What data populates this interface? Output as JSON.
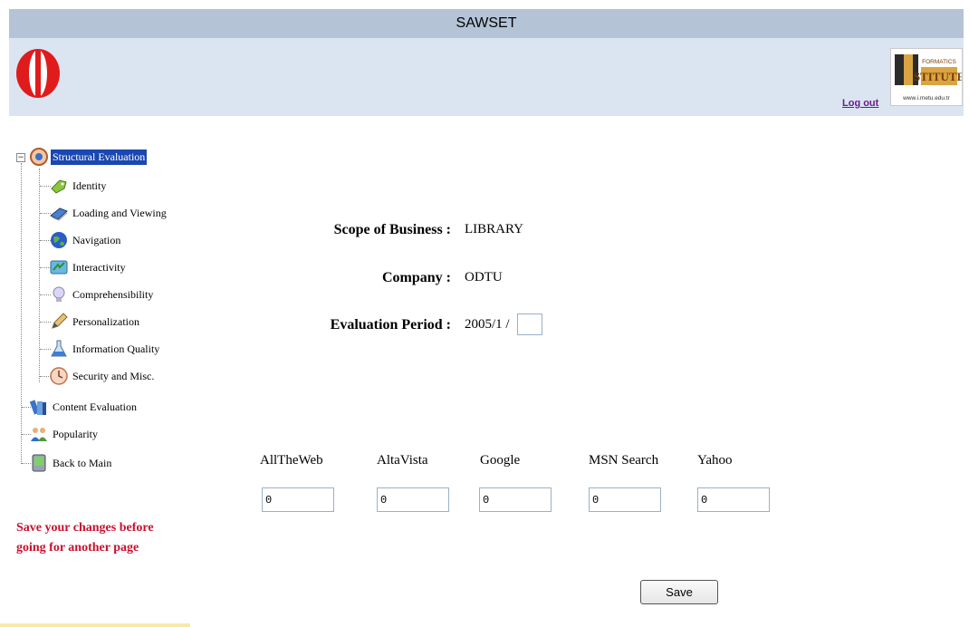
{
  "app": {
    "title": "SAWSET"
  },
  "header": {
    "logout_label": "Log out",
    "institute_logo_text": "INFORMATICS INSTITUTE",
    "institute_logo_url": "www.i.metu.edu.tr"
  },
  "tree": {
    "items": [
      {
        "label": "Structural Evaluation",
        "icon": "compass-icon"
      },
      {
        "label": "Identity",
        "icon": "tag-icon"
      },
      {
        "label": "Loading and Viewing",
        "icon": "book-icon"
      },
      {
        "label": "Navigation",
        "icon": "globe-icon"
      },
      {
        "label": "Interactivity",
        "icon": "arrows-icon"
      },
      {
        "label": "Comprehensibility",
        "icon": "lightbulb-icon"
      },
      {
        "label": "Personalization",
        "icon": "pencil-icon"
      },
      {
        "label": "Information Quality",
        "icon": "flask-icon"
      },
      {
        "label": "Security and Misc.",
        "icon": "clock-icon"
      },
      {
        "label": "Content Evaluation",
        "icon": "books-icon"
      },
      {
        "label": "Popularity",
        "icon": "people-icon"
      },
      {
        "label": "Back to Main",
        "icon": "pda-icon"
      }
    ]
  },
  "warning": {
    "line1": "Save your changes before",
    "line2": "going for another page"
  },
  "form": {
    "scope_label": "Scope of Business :",
    "scope_value": "LIBRARY",
    "company_label": "Company :",
    "company_value": "ODTU",
    "period_label": "Evaluation Period :",
    "period_value": "2005/1 /",
    "period_input": ""
  },
  "engines": [
    {
      "name": "AllTheWeb",
      "value": "0"
    },
    {
      "name": "AltaVista",
      "value": "0"
    },
    {
      "name": "Google",
      "value": "0"
    },
    {
      "name": "MSN Search",
      "value": "0"
    },
    {
      "name": "Yahoo",
      "value": "0"
    }
  ],
  "save_label": "Save",
  "colors": {
    "title_bar": "#b4c4d6",
    "banner": "#dbe5f1",
    "selected": "#1a47b0",
    "warning": "#c8102e",
    "logout": "#6a1b8a"
  }
}
